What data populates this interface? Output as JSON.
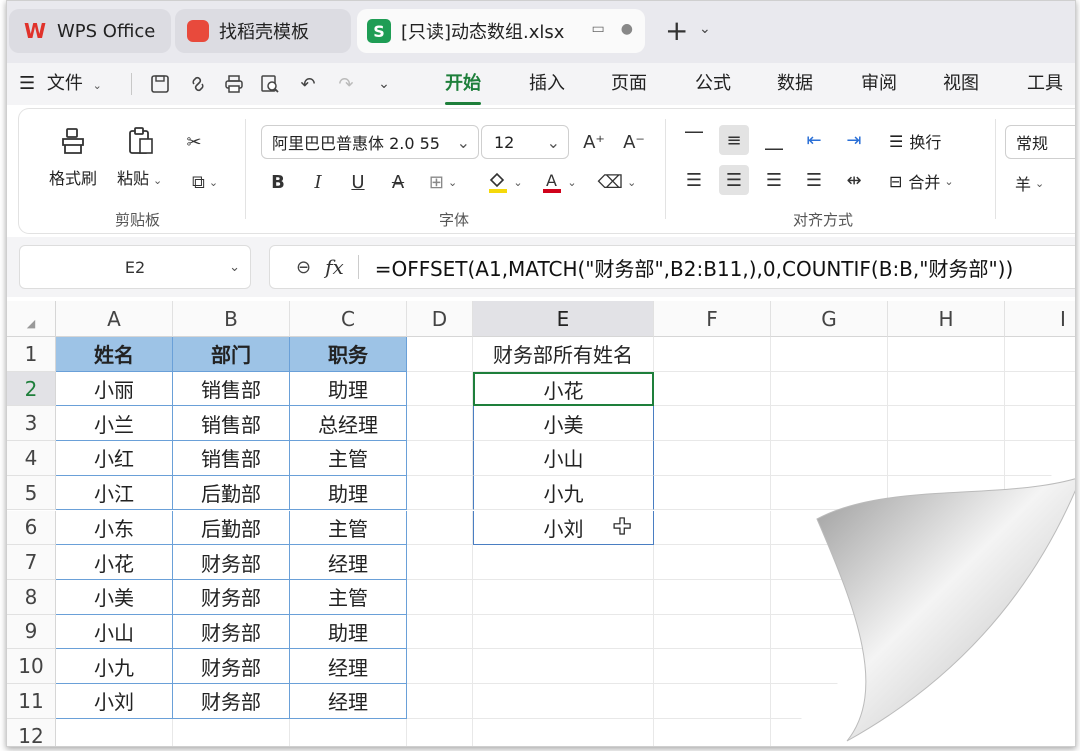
{
  "tabs": [
    {
      "label": "WPS Office",
      "icon": "wps-logo-icon"
    },
    {
      "label": "找稻壳模板",
      "icon": "docer-logo-icon"
    },
    {
      "label": "[只读]动态数组.xlsx",
      "icon": "spreadsheet-icon",
      "badge": "S"
    }
  ],
  "menu": {
    "file": "文件",
    "items": [
      "开始",
      "插入",
      "页面",
      "公式",
      "数据",
      "审阅",
      "视图",
      "工具"
    ],
    "active": "开始"
  },
  "ribbon": {
    "clipboard": {
      "format_painter": "格式刷",
      "paste": "粘贴",
      "group": "剪贴板"
    },
    "font": {
      "name": "阿里巴巴普惠体 2.0 55",
      "size": "12",
      "group": "字体",
      "bold": "B",
      "italic": "I",
      "underline": "U",
      "strike": "A",
      "font_color": "#d0021b",
      "highlight": "#f5d90a",
      "grow": "A⁺",
      "shrink": "A⁻"
    },
    "align": {
      "wrap": "换行",
      "merge": "合并",
      "group": "对齐方式"
    },
    "number": {
      "format": "常规",
      "currency": "羊"
    }
  },
  "formula_bar": {
    "name_box": "E2",
    "formula": "=OFFSET(A1,MATCH(\"财务部\",B2:B11,),0,COUNTIF(B:B,\"财务部\"))"
  },
  "sheet": {
    "columns": [
      "A",
      "B",
      "C",
      "D",
      "E",
      "F",
      "G",
      "H",
      "I"
    ],
    "selected_column": "E",
    "rows": [
      "1",
      "2",
      "3",
      "4",
      "5",
      "6",
      "7",
      "8",
      "9",
      "10",
      "11",
      "12"
    ],
    "selected_row": "2",
    "table_header": [
      "姓名",
      "部门",
      "职务"
    ],
    "table_rows": [
      [
        "小丽",
        "销售部",
        "助理"
      ],
      [
        "小兰",
        "销售部",
        "总经理"
      ],
      [
        "小红",
        "销售部",
        "主管"
      ],
      [
        "小江",
        "后勤部",
        "助理"
      ],
      [
        "小东",
        "后勤部",
        "主管"
      ],
      [
        "小花",
        "财务部",
        "经理"
      ],
      [
        "小美",
        "财务部",
        "主管"
      ],
      [
        "小山",
        "财务部",
        "助理"
      ],
      [
        "小九",
        "财务部",
        "经理"
      ],
      [
        "小刘",
        "财务部",
        "经理"
      ]
    ],
    "result_header": "财务部所有姓名",
    "result_values": [
      "小花",
      "小美",
      "小山",
      "小九",
      "小刘"
    ],
    "header_fill": "#9dc3e6",
    "active_border": "#1e7f3b"
  }
}
